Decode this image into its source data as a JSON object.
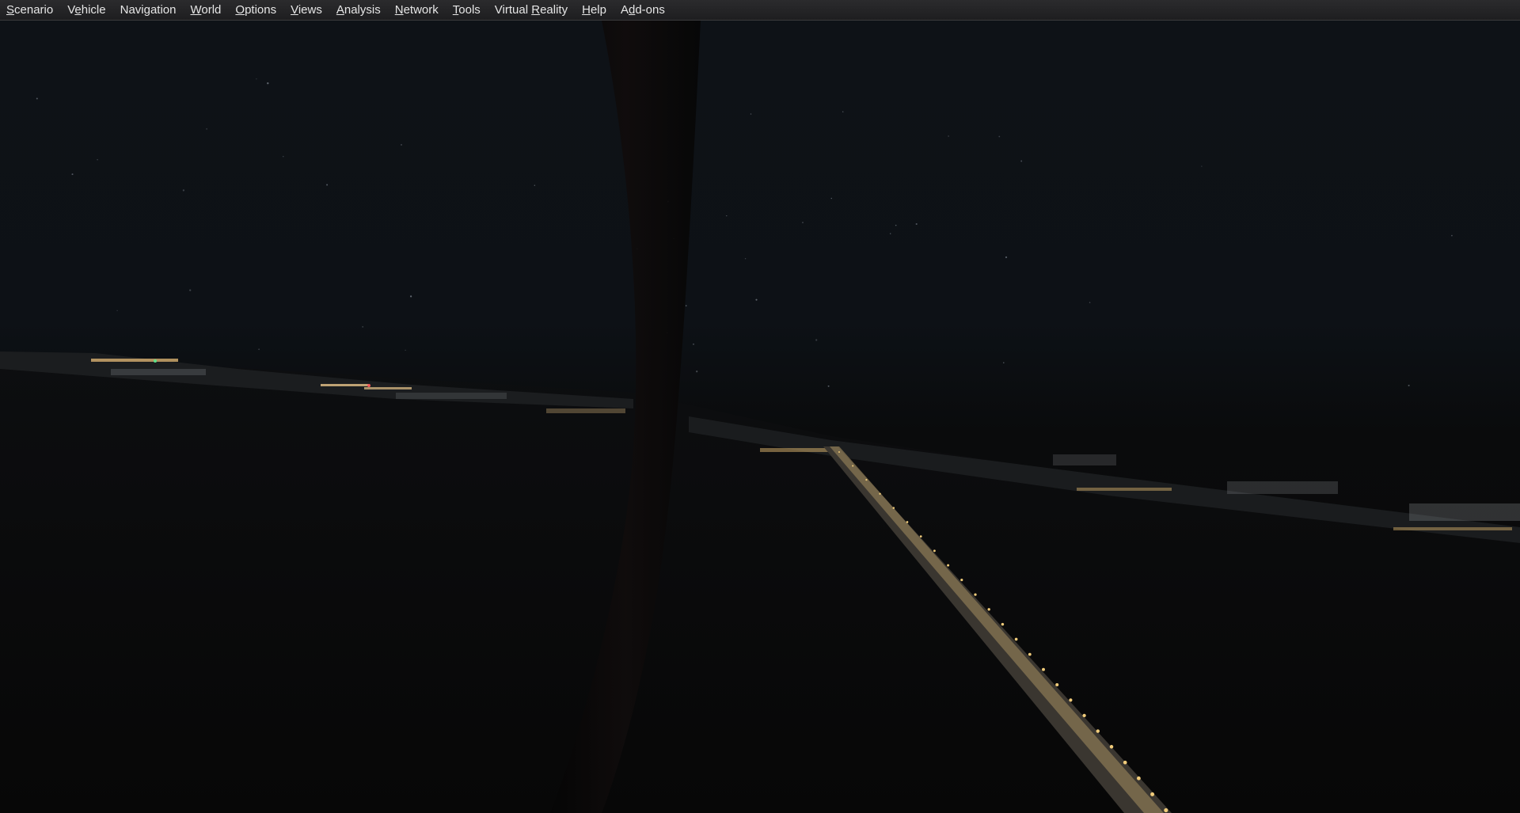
{
  "app": {
    "menu": [
      {
        "id": "scenario",
        "label": "Scenario",
        "accel": "S"
      },
      {
        "id": "vehicle",
        "label": "Vehicle",
        "accel": "e"
      },
      {
        "id": "navigation",
        "label": "Navigation",
        "accel": ""
      },
      {
        "id": "world",
        "label": "World",
        "accel": "W"
      },
      {
        "id": "options",
        "label": "Options",
        "accel": "O"
      },
      {
        "id": "views",
        "label": "Views",
        "accel": "V"
      },
      {
        "id": "analysis",
        "label": "Analysis",
        "accel": "A"
      },
      {
        "id": "network",
        "label": "Network",
        "accel": "N"
      },
      {
        "id": "tools",
        "label": "Tools",
        "accel": "T"
      },
      {
        "id": "virtual-reality",
        "label": "Virtual Reality",
        "accel": "R"
      },
      {
        "id": "help",
        "label": "Help",
        "accel": "H"
      },
      {
        "id": "add-ons",
        "label": "Add-ons",
        "accel": "d"
      }
    ]
  },
  "scene": {
    "description_colors": {
      "sky": "#0e1217",
      "ground": "#080808",
      "lights": "#e8c27a",
      "frame": "#050505"
    }
  }
}
